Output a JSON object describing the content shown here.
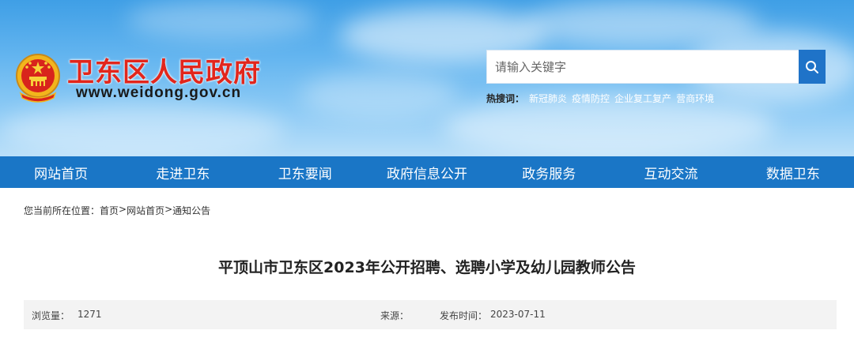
{
  "header": {
    "site_title": "卫东区人民政府",
    "site_url": "www.weidong.gov.cn",
    "search": {
      "placeholder": "请输入关键字"
    },
    "hot": {
      "label": "热搜词：",
      "items": [
        "新冠肺炎",
        "疫情防控",
        "企业复工复产",
        "营商环境"
      ]
    }
  },
  "nav": {
    "items": [
      "网站首页",
      "走进卫东",
      "卫东要闻",
      "政府信息公开",
      "政务服务",
      "互动交流",
      "数据卫东"
    ]
  },
  "breadcrumb": {
    "prefix": "您当前所在位置：",
    "items": [
      "首页",
      "网站首页",
      "通知公告"
    ],
    "separator": ">"
  },
  "article": {
    "title": "平顶山市卫东区2023年公开招聘、选聘小学及幼儿园教师公告",
    "views_label": "浏览量：",
    "views_value": "1271",
    "source_label": "来源：",
    "date_label": "发布时间：",
    "date_value": "2023-07-11"
  },
  "colors": {
    "nav_bg": "#1a76c6",
    "title_red": "#e2261c",
    "search_btn": "#1f73c8"
  },
  "icons": {
    "emblem": "national-emblem-icon",
    "search": "search-icon"
  }
}
